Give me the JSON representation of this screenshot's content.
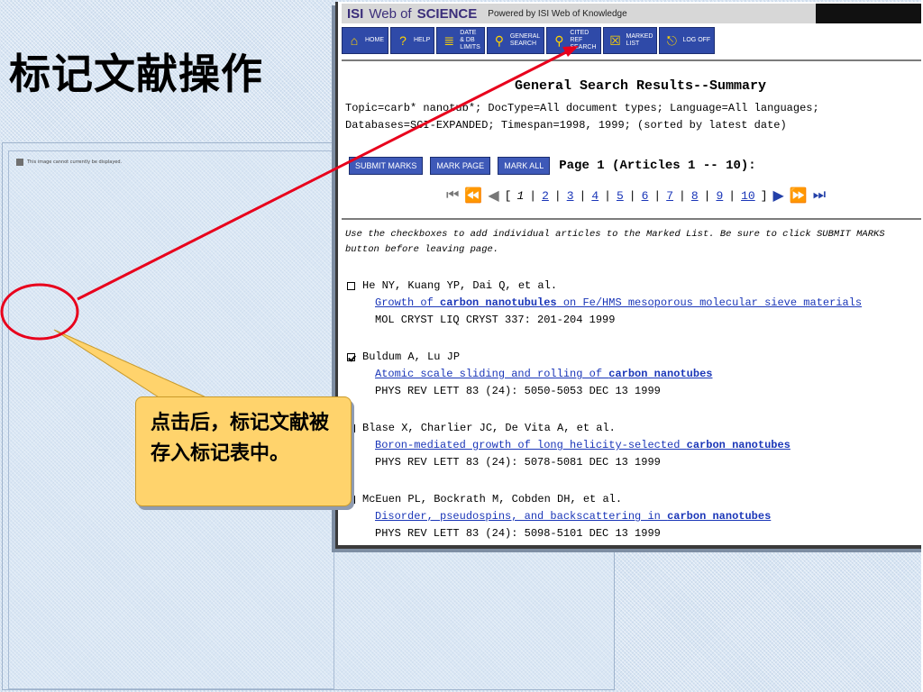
{
  "slide": {
    "title": "标记文献操作",
    "placeholder_text": "This image cannot currently be displayed.",
    "callout_text": "点击后，标记文献被存入标记表中。"
  },
  "header": {
    "logo_isi": "ISI",
    "logo_web_of": "Web of",
    "logo_science": "SCIENCE",
    "powered_by": "Powered by ISI Web of Knowledge"
  },
  "toolbar": {
    "buttons": [
      {
        "label": "HOME",
        "icon": "home-icon"
      },
      {
        "label": "HELP",
        "icon": "help-icon"
      },
      {
        "label": "DATE\n& DB\nLIMITS",
        "icon": "database-icon"
      },
      {
        "label": "GENERAL\nSEARCH",
        "icon": "search-icon"
      },
      {
        "label": "CITED\nREF\nSEARCH",
        "icon": "search-icon"
      },
      {
        "label": "MARKED\nLIST",
        "icon": "marked-list-icon"
      },
      {
        "label": "LOG OFF",
        "icon": "logoff-icon"
      }
    ]
  },
  "results": {
    "title": "General Search Results--Summary",
    "query": "Topic=carb* nanotub*; DocType=All document types; Language=All languages; Databases=SCI-EXPANDED; Timespan=1998, 1999; (sorted by latest date)",
    "buttons": {
      "submit": "SUBMIT MARKS",
      "mark_page": "MARK PAGE",
      "mark_all": "MARK ALL"
    },
    "page_info": "Page 1 (Articles 1 -- 10):",
    "pager": {
      "bracket_open": "[",
      "current": "1",
      "pages": [
        "2",
        "3",
        "4",
        "5",
        "6",
        "7",
        "8",
        "9",
        "10"
      ],
      "bracket_close": "]"
    },
    "instructions": "Use the checkboxes to add individual articles to the Marked List. Be sure to click SUBMIT MARKS button before leaving page.",
    "articles": [
      {
        "authors": "He NY, Kuang YP, Dai Q, et al.",
        "title_pre": "Growth of ",
        "title_bold": "carbon nanotubules",
        "title_post": " on Fe/HMS mesoporous molecular sieve materials",
        "source": "MOL CRYST LIQ CRYST 337: 201-204 1999",
        "checked": false
      },
      {
        "authors": "Buldum A, Lu JP",
        "title_pre": "Atomic scale sliding and rolling of ",
        "title_bold": "carbon nanotubes",
        "title_post": "",
        "source": "PHYS REV LETT 83 (24): 5050-5053 DEC 13 1999",
        "checked": true
      },
      {
        "authors": "Blase X, Charlier JC, De Vita A, et al.",
        "title_pre": "Boron-mediated growth of long helicity-selected ",
        "title_bold": "carbon nanotubes",
        "title_post": "",
        "source": "PHYS REV LETT 83 (24): 5078-5081 DEC 13 1999",
        "checked": false
      },
      {
        "authors": "McEuen PL, Bockrath M, Cobden DH, et al.",
        "title_pre": "Disorder, pseudospins, and backscattering in ",
        "title_bold": "carbon nanotubes",
        "title_post": "",
        "source": "PHYS REV LETT 83 (24): 5098-5101 DEC 13 1999",
        "checked": false
      }
    ]
  },
  "colors": {
    "annotation_red": "#e8001c",
    "callout_fill": "#ffd36c",
    "toolbar_blue": "#2f4aa8",
    "link_blue": "#1a36b8"
  }
}
